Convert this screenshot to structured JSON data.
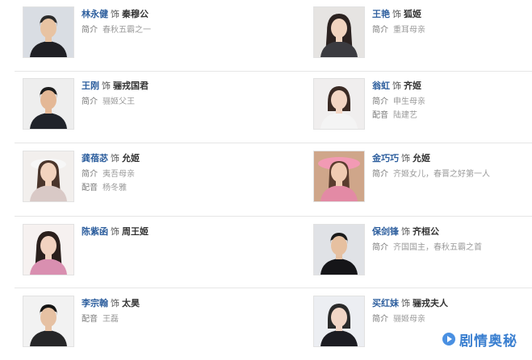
{
  "cast": [
    {
      "actor": "林永健",
      "plays": "饰",
      "role": "秦穆公",
      "lines": [
        {
          "label": "简介",
          "value": "春秋五霸之一"
        }
      ]
    },
    {
      "actor": "王艳",
      "plays": "饰",
      "role": "狐姬",
      "lines": [
        {
          "label": "简介",
          "value": "重耳母亲"
        }
      ]
    },
    {
      "actor": "王刚",
      "plays": "饰",
      "role": "骊戎国君",
      "lines": [
        {
          "label": "简介",
          "value": "骊姬父王"
        }
      ]
    },
    {
      "actor": "翁虹",
      "plays": "饰",
      "role": "齐姬",
      "lines": [
        {
          "label": "简介",
          "value": "申生母亲"
        },
        {
          "label": "配音",
          "value": "陆建艺"
        }
      ]
    },
    {
      "actor": "龚蓓苾",
      "plays": "饰",
      "role": "允姬",
      "lines": [
        {
          "label": "简介",
          "value": "夷吾母亲"
        },
        {
          "label": "配音",
          "value": "杨冬雅"
        }
      ]
    },
    {
      "actor": "金巧巧",
      "plays": "饰",
      "role": "允姬",
      "lines": [
        {
          "label": "简介",
          "value": "齐姬女儿，春晋之好第一人"
        }
      ]
    },
    {
      "actor": "陈紫函",
      "plays": "饰",
      "role": "周王姬",
      "lines": []
    },
    {
      "actor": "保剑锋",
      "plays": "饰",
      "role": "齐桓公",
      "lines": [
        {
          "label": "简介",
          "value": "齐国国主，春秋五霸之首"
        }
      ]
    },
    {
      "actor": "李宗翰",
      "plays": "饰",
      "role": "太昊",
      "lines": [
        {
          "label": "配音",
          "value": "王磊"
        }
      ]
    },
    {
      "actor": "买红妹",
      "plays": "饰",
      "role": "骊戎夫人",
      "lines": [
        {
          "label": "简介",
          "value": "骊姬母亲"
        }
      ]
    }
  ],
  "watermark": {
    "text": "剧情奥秘",
    "color": "#3a7fd0"
  }
}
